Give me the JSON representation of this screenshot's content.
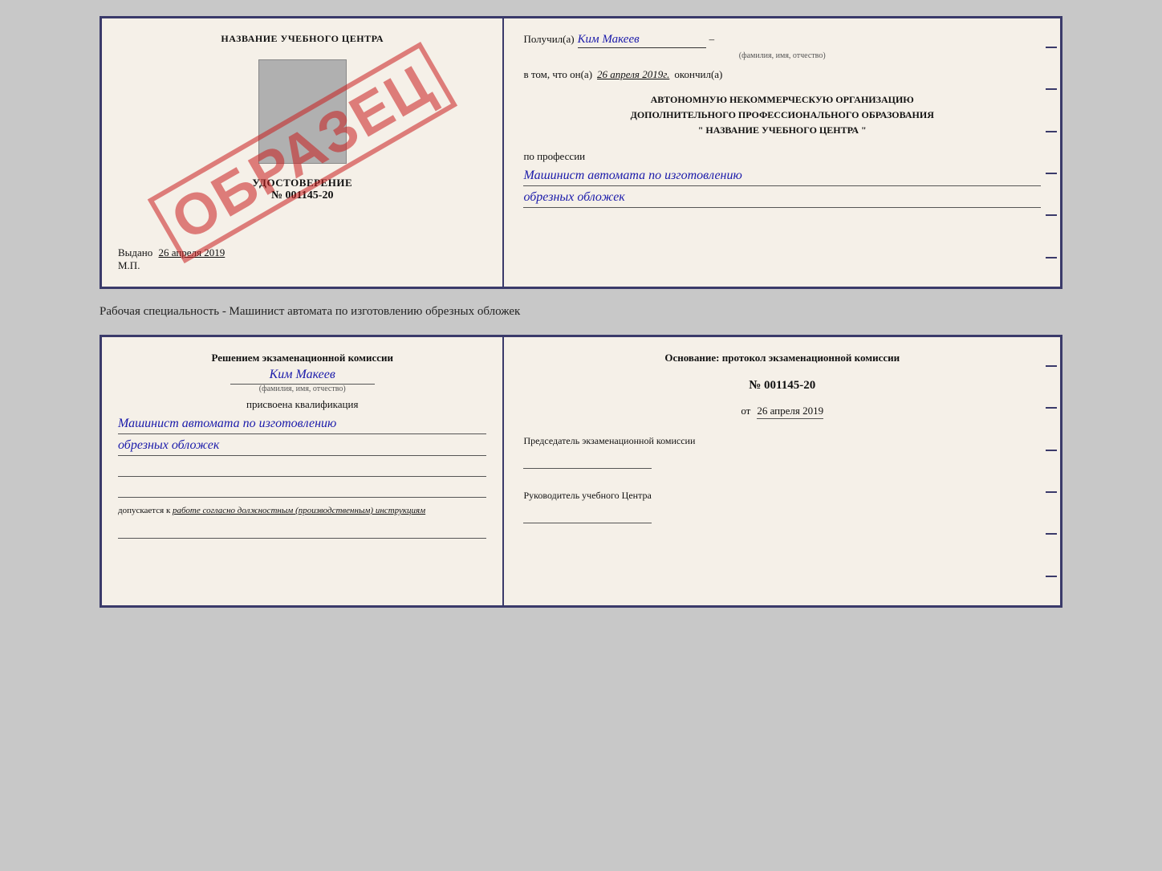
{
  "top_doc": {
    "left": {
      "header": "НАЗВАНИЕ УЧЕБНОГО ЦЕНТРА",
      "udostoverenie_title": "УДОСТОВЕРЕНИЕ",
      "udostoverenie_num": "№ 001145-20",
      "vydano_label": "Выдано",
      "vydano_date": "26 апреля 2019",
      "mp_label": "М.П.",
      "stamp_text": "ОБРАЗЕЦ"
    },
    "right": {
      "poluchil_label": "Получил(а)",
      "poluchil_name": "Ким Макеев",
      "fio_sub": "(фамилия, имя, отчество)",
      "dash": "–",
      "vtom_label": "в том, что он(а)",
      "vtom_date": "26 апреля 2019г.",
      "vtom_okonchil": "окончил(а)",
      "org_line1": "АВТОНОМНУЮ НЕКОММЕРЧЕСКУЮ ОРГАНИЗАЦИЮ",
      "org_line2": "ДОПОЛНИТЕЛЬНОГО ПРОФЕССИОНАЛЬНОГО ОБРАЗОВАНИЯ",
      "org_name": "\" НАЗВАНИЕ УЧЕБНОГО ЦЕНТРА \"",
      "po_professii": "по профессии",
      "profession1": "Машинист автомата по изготовлению",
      "profession2": "обрезных обложек"
    }
  },
  "caption": "Рабочая специальность - Машинист автомата по изготовлению обрезных обложек",
  "bottom_doc": {
    "left": {
      "resheniem_title": "Решением экзаменационной комиссии",
      "name": "Ким Макеев",
      "fio_sub": "(фамилия, имя, отчество)",
      "prisvoena": "присвоена квалификация",
      "qualification1": "Машинист автомата по изготовлению",
      "qualification2": "обрезных обложек",
      "dopuskaetsya_label": "допускается к",
      "dopuskaetsya_text": "работе согласно должностным (производственным) инструкциям"
    },
    "right": {
      "osnovanie_title": "Основание: протокол экзаменационной комиссии",
      "protocol_num": "№ 001145-20",
      "ot_label": "от",
      "ot_date": "26 апреля 2019",
      "predsedatel_title": "Председатель экзаменационной комиссии",
      "rukovoditel_title": "Руководитель учебного Центра"
    }
  }
}
